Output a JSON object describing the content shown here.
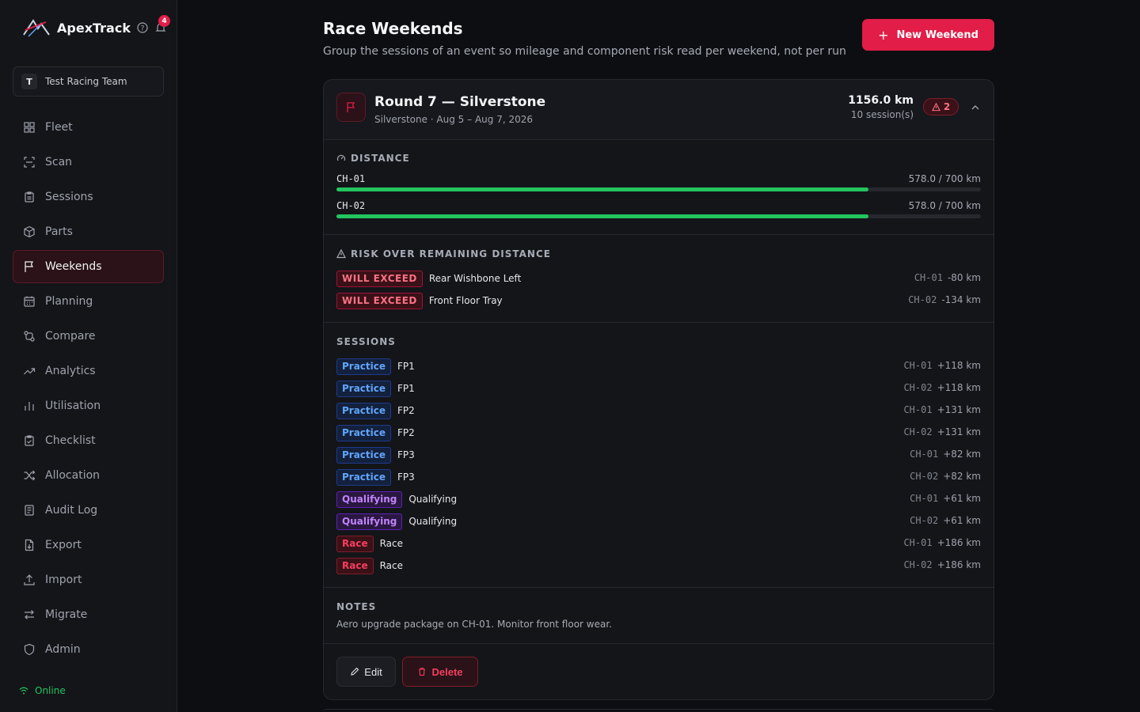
{
  "app": {
    "name": "ApexTrack",
    "notifications_count": "4",
    "team_initial": "T",
    "team_name": "Test Racing Team",
    "status": "Online",
    "accent_color": "#e11d48"
  },
  "nav": {
    "items": [
      {
        "label": "Fleet",
        "icon": "grid-icon"
      },
      {
        "label": "Scan",
        "icon": "scan-icon"
      },
      {
        "label": "Sessions",
        "icon": "clipboard-icon"
      },
      {
        "label": "Parts",
        "icon": "box-icon"
      },
      {
        "label": "Weekends",
        "icon": "flag-icon",
        "active": true
      },
      {
        "label": "Planning",
        "icon": "calendar-icon"
      },
      {
        "label": "Compare",
        "icon": "compare-icon"
      },
      {
        "label": "Analytics",
        "icon": "trend-icon"
      },
      {
        "label": "Utilisation",
        "icon": "bar-chart-icon"
      },
      {
        "label": "Checklist",
        "icon": "clipboard-check-icon"
      },
      {
        "label": "Allocation",
        "icon": "shuffle-icon"
      },
      {
        "label": "Audit Log",
        "icon": "log-icon"
      },
      {
        "label": "Export",
        "icon": "file-export-icon"
      },
      {
        "label": "Import",
        "icon": "upload-icon"
      },
      {
        "label": "Migrate",
        "icon": "arrows-icon"
      },
      {
        "label": "Admin",
        "icon": "shield-icon"
      }
    ]
  },
  "header": {
    "title": "Race Weekends",
    "subtitle": "Group the sessions of an event so mileage and component risk read per weekend, not per run",
    "new_button": "New Weekend"
  },
  "weekend": {
    "title": "Round 7 — Silverstone",
    "subtitle": "Silverstone · Aug 5 – Aug 7, 2026",
    "total_km": "1156.0 km",
    "session_count": "10 session(s)",
    "warning_count": "2",
    "expanded": true,
    "distance_label": "DISTANCE",
    "distance": [
      {
        "id": "CH-01",
        "text": "578.0 / 700 km",
        "fraction": 0.8257
      },
      {
        "id": "CH-02",
        "text": "578.0 / 700 km",
        "fraction": 0.8257
      }
    ],
    "risk_label": "RISK OVER REMAINING DISTANCE",
    "risks": [
      {
        "tag": "WILL EXCEED",
        "part": "Rear Wishbone Left",
        "chassis": "CH-01",
        "delta": "-80 km"
      },
      {
        "tag": "WILL EXCEED",
        "part": "Front Floor Tray",
        "chassis": "CH-02",
        "delta": "-134 km"
      }
    ],
    "sessions_label": "SESSIONS",
    "sessions": [
      {
        "type": "Practice",
        "name": "FP1",
        "chassis": "CH-01",
        "km": "+118 km"
      },
      {
        "type": "Practice",
        "name": "FP1",
        "chassis": "CH-02",
        "km": "+118 km"
      },
      {
        "type": "Practice",
        "name": "FP2",
        "chassis": "CH-01",
        "km": "+131 km"
      },
      {
        "type": "Practice",
        "name": "FP2",
        "chassis": "CH-02",
        "km": "+131 km"
      },
      {
        "type": "Practice",
        "name": "FP3",
        "chassis": "CH-01",
        "km": "+82 km"
      },
      {
        "type": "Practice",
        "name": "FP3",
        "chassis": "CH-02",
        "km": "+82 km"
      },
      {
        "type": "Qualifying",
        "name": "Qualifying",
        "chassis": "CH-01",
        "km": "+61 km"
      },
      {
        "type": "Qualifying",
        "name": "Qualifying",
        "chassis": "CH-02",
        "km": "+61 km"
      },
      {
        "type": "Race",
        "name": "Race",
        "chassis": "CH-01",
        "km": "+186 km"
      },
      {
        "type": "Race",
        "name": "Race",
        "chassis": "CH-02",
        "km": "+186 km"
      }
    ],
    "notes_label": "NOTES",
    "notes": "Aero upgrade package on CH-01. Monitor front floor wear.",
    "edit_button": "Edit",
    "delete_button": "Delete"
  }
}
